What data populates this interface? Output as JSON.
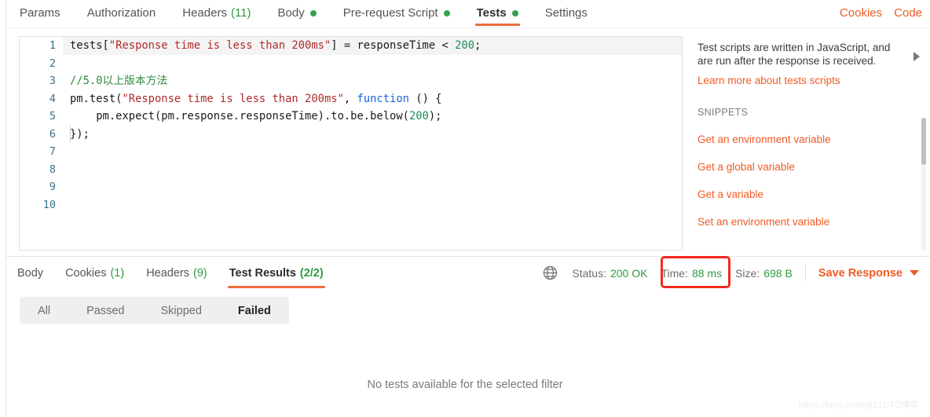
{
  "request_tabs": [
    {
      "label": "Params",
      "active": false,
      "count": null,
      "dot": false
    },
    {
      "label": "Authorization",
      "active": false,
      "count": null,
      "dot": false
    },
    {
      "label": "Headers",
      "active": false,
      "count": "(11)",
      "dot": false
    },
    {
      "label": "Body",
      "active": false,
      "count": null,
      "dot": true
    },
    {
      "label": "Pre-request Script",
      "active": false,
      "count": null,
      "dot": true
    },
    {
      "label": "Tests",
      "active": true,
      "count": null,
      "dot": true
    },
    {
      "label": "Settings",
      "active": false,
      "count": null,
      "dot": false
    }
  ],
  "tabbar_right": {
    "cookies_label": "Cookies",
    "code_label": "Code"
  },
  "editor": {
    "line_numbers": [
      "1",
      "2",
      "3",
      "4",
      "5",
      "6",
      "7",
      "8",
      "9",
      "10"
    ],
    "code": {
      "l1_a": "tests[",
      "l1_str": "\"Response time is less than 200ms\"",
      "l1_b": "] = responseTime < ",
      "l1_num": "200",
      "l1_c": ";",
      "l3_comment": "//5.0以上版本方法",
      "l4_a": "pm.test(",
      "l4_str": "\"Response time is less than 200ms\"",
      "l4_b": ", ",
      "l4_kw": "function",
      "l4_c": " () {",
      "l5_a": "    pm.expect(pm.response.responseTime).to.be.below(",
      "l5_num": "200",
      "l5_b": ");",
      "l6": "});"
    }
  },
  "docs": {
    "description": "Test scripts are written in JavaScript, and are run after the response is received.",
    "learn_more": "Learn more about tests scripts",
    "snippets_header": "SNIPPETS",
    "snippets": [
      "Get an environment variable",
      "Get a global variable",
      "Get a variable",
      "Set an environment variable"
    ]
  },
  "response_tabs": [
    {
      "label": "Body",
      "count": null,
      "active": false
    },
    {
      "label": "Cookies",
      "count": "(1)",
      "active": false
    },
    {
      "label": "Headers",
      "count": "(9)",
      "active": false
    },
    {
      "label": "Test Results",
      "count": "(2/2)",
      "active": true
    }
  ],
  "response_meta": {
    "status_label": "Status:",
    "status_value": "200 OK",
    "time_label": "Time:",
    "time_value": "88 ms",
    "size_label": "Size:",
    "size_value": "698 B",
    "save_response": "Save Response"
  },
  "filters": [
    {
      "label": "All",
      "active": false
    },
    {
      "label": "Passed",
      "active": false
    },
    {
      "label": "Skipped",
      "active": false
    },
    {
      "label": "Failed",
      "active": true
    }
  ],
  "empty_message": "No tests available for the selected filter",
  "watermark": "https://blog.csdn@51CTO博客",
  "colors": {
    "accent_orange": "#ef5b25",
    "underline_orange": "#ef6c3d",
    "green": "#2f9a41",
    "annotation_red": "#f4291d"
  }
}
